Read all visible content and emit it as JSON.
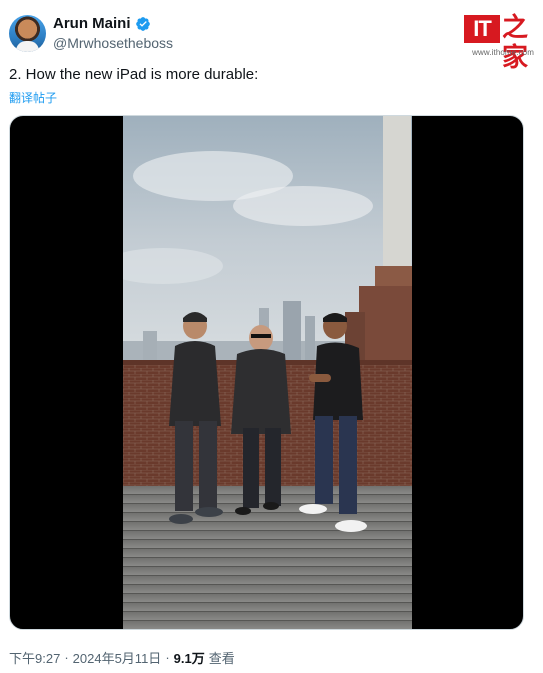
{
  "author": {
    "name": "Arun Maini",
    "handle": "@Mrwhosetheboss",
    "verified_icon": "verified-badge-icon",
    "verified_color": "#1d9bf0"
  },
  "watermark": {
    "logo_text": "IT",
    "logo_cn": "之家",
    "url": "www.ithome.com",
    "color": "#d71920"
  },
  "tweet": {
    "text": "2. How the new iPad is more durable:",
    "translate_label": "翻译帖子"
  },
  "media": {
    "type": "video",
    "description_icon": "video-frame"
  },
  "footer": {
    "time": "下午9:27",
    "separator1": "·",
    "date": "2024年5月11日",
    "separator2": "·",
    "views_count": "9.1万",
    "views_label": "查看"
  }
}
